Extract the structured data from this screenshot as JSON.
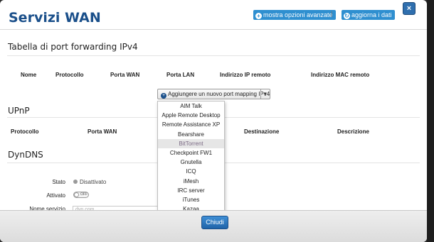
{
  "dialog": {
    "title": "Servizi WAN",
    "advanced_label": "mostra opzioni avanzate",
    "separator": "|",
    "refresh_label": "aggiorna i dati",
    "close_symbol": "×"
  },
  "port_forwarding": {
    "title": "Tabella di port forwarding IPv4",
    "columns": [
      "Nome",
      "Protocollo",
      "Porta WAN",
      "Porta LAN",
      "Indirizzo IP remoto",
      "Indirizzo MAC remoto"
    ],
    "add_button": "Aggiungere un nuovo port mapping IPv4",
    "add_icon": "plus-circle-icon",
    "caret": "▾"
  },
  "upnp": {
    "title": "UPnP",
    "columns": [
      "Protocollo",
      "Porta WAN",
      "Destinazione",
      "Descrizione"
    ]
  },
  "dropdown": {
    "items": [
      "AIM Talk",
      "Apple Remote Desktop",
      "Remote Assistance XP",
      "Bearshare",
      "BitTorrent",
      "Checkpoint FW1",
      "Gnutella",
      "ICQ",
      "iMesh",
      "IRC server",
      "iTunes",
      "Kazaa"
    ],
    "highlighted": "BitTorrent"
  },
  "dyndns": {
    "title": "DynDNS",
    "stato_label": "Stato",
    "stato_value": "Disattivato",
    "attivato_label": "Attivato",
    "toggle_text": "OFF",
    "service_label": "Nome servizio",
    "service_value": "dyn.com"
  },
  "footer": {
    "close_label": "Chiudi"
  },
  "colors": {
    "title": "#1a4f8a",
    "button_blue": "#2f8fd0",
    "highlight": "#e6e6e6"
  }
}
